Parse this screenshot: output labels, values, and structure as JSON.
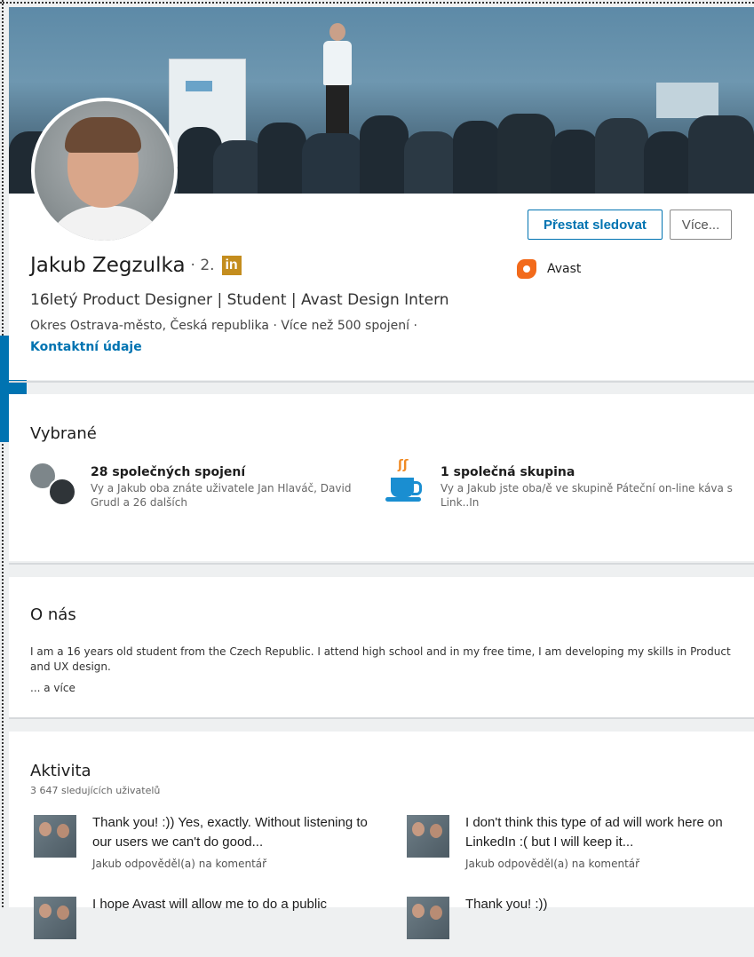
{
  "profile": {
    "name": "Jakub Zegzulka",
    "degree": "· 2.",
    "badge": "in",
    "headline": "16letý Product Designer | Student | Avast Design Intern",
    "location": "Okres Ostrava-město, Česká republika  ·  Více než 500 spojení  ·",
    "contact": "Kontaktní údaje",
    "company": "Avast"
  },
  "actions": {
    "follow_label": "Přestat sledovat",
    "more_label": "Více..."
  },
  "highlights": {
    "title": "Vybrané",
    "items": [
      {
        "title": "28 společných spojení",
        "desc": "Vy a Jakub oba znáte uživatele Jan Hlaváč, David Grudl a 26 dalších"
      },
      {
        "title": "1 společná skupina",
        "desc": "Vy a Jakub jste oba/ě ve skupině Páteční on-line káva s Link..In"
      }
    ]
  },
  "about": {
    "title": "O nás",
    "text": "I am a 16 years old student from the Czech Republic. I attend high school and in my free time, I am developing my skills in Product and UX design.",
    "more": "... a více"
  },
  "activity": {
    "title": "Aktivita",
    "followers": "3 647 sledujících uživatelů",
    "items": [
      {
        "title": "Thank you! :)) Yes, exactly. Without listening to our users we can't do good...",
        "meta": "Jakub odpověděl(a) na komentář"
      },
      {
        "title": "I don't think this type of ad will work here on LinkedIn :( but I will keep it...",
        "meta": "Jakub odpověděl(a) na komentář"
      },
      {
        "title": "I hope Avast will allow me to do a public",
        "meta": ""
      },
      {
        "title": "Thank you! :))",
        "meta": ""
      }
    ]
  },
  "icons": {
    "company": "avast-logo-icon",
    "group": "coffee-cup-icon",
    "badge_color": "#c48d1e",
    "accent": "#0073b1"
  }
}
